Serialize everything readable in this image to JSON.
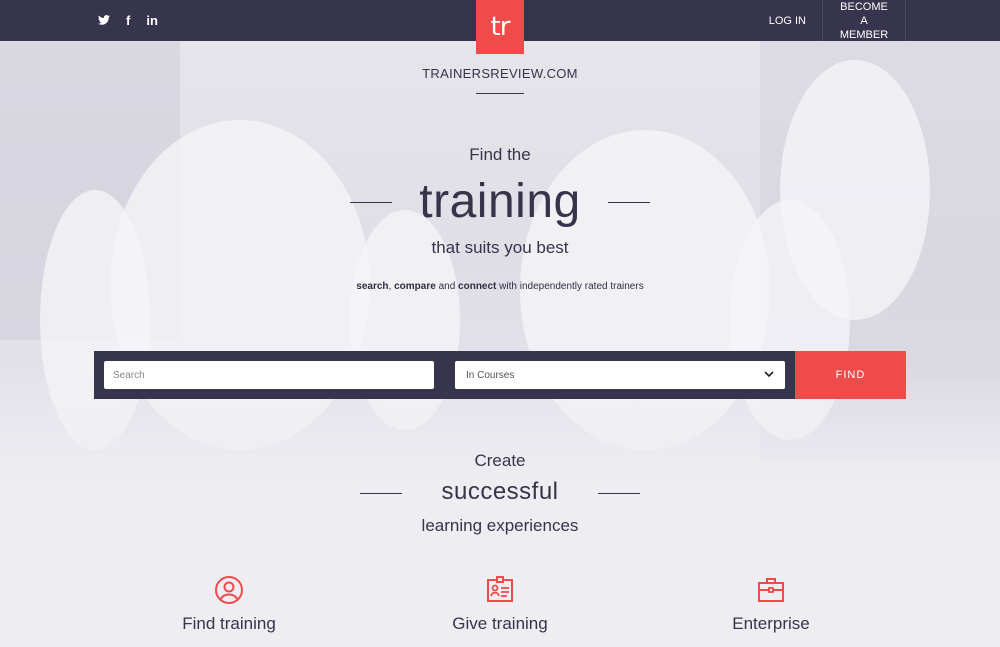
{
  "topbar": {
    "social": [
      {
        "icon": "twitter-icon",
        "glyph": "🐦"
      },
      {
        "icon": "facebook-icon",
        "glyph": "f"
      },
      {
        "icon": "linkedin-icon",
        "glyph": "in"
      }
    ],
    "logo_text": "tr",
    "login_label": "LOG IN",
    "member_label": "BECOME A MEMBER"
  },
  "site_name": "TRAINERSREVIEW.COM",
  "hero": {
    "line1": "Find the",
    "line2": "training",
    "line3": "that suits you best",
    "sub_search": "search",
    "sub_sep": ", ",
    "sub_compare": "compare",
    "sub_and": " and ",
    "sub_connect": "connect",
    "sub_rest": " with independently rated trainers"
  },
  "search": {
    "placeholder": "Search",
    "select_value": "In Courses",
    "find_label": "FIND"
  },
  "create": {
    "line1": "Create",
    "line2": "successful",
    "line3": "learning experiences"
  },
  "features": [
    {
      "label": "Find training",
      "icon": "user-circle-icon"
    },
    {
      "label": "Give training",
      "icon": "id-card-icon"
    },
    {
      "label": "Enterprise",
      "icon": "briefcase-icon"
    }
  ],
  "colors": {
    "accent": "#ef4b4b",
    "dark": "#37354d",
    "background": "#eeedf2"
  }
}
